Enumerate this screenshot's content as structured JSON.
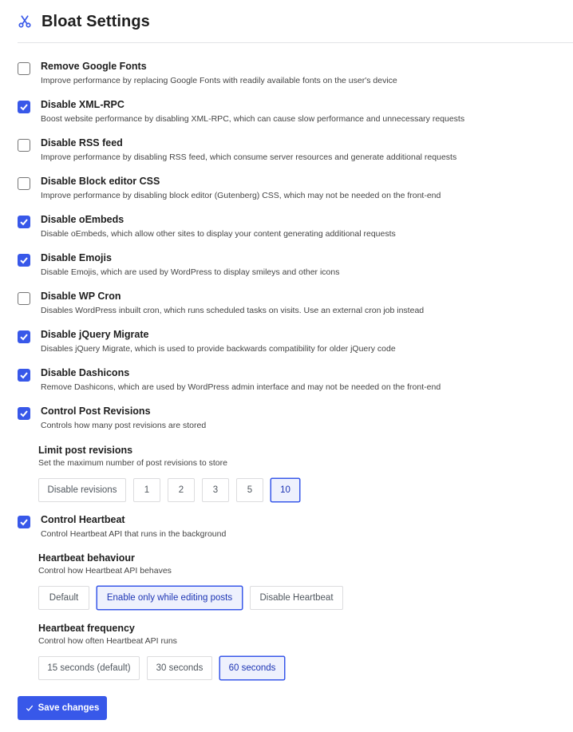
{
  "header": {
    "title": "Bloat Settings",
    "icon": "scissors-icon"
  },
  "accent": "#3858e9",
  "settings": [
    {
      "label": "Remove Google Fonts",
      "desc": "Improve performance by replacing Google Fonts with readily available fonts on the user's device",
      "checked": false
    },
    {
      "label": "Disable XML-RPC",
      "desc": "Boost website performance by disabling XML-RPC, which can cause slow performance and unnecessary requests",
      "checked": true
    },
    {
      "label": "Disable RSS feed",
      "desc": "Improve performance by disabling RSS feed, which consume server resources and generate additional requests",
      "checked": false
    },
    {
      "label": "Disable Block editor CSS",
      "desc": "Improve performance by disabling block editor (Gutenberg) CSS, which may not be needed on the front-end",
      "checked": false
    },
    {
      "label": "Disable oEmbeds",
      "desc": "Disable oEmbeds, which allow other sites to display your content generating additional requests",
      "checked": true
    },
    {
      "label": "Disable Emojis",
      "desc": "Disable Emojis, which are used by WordPress to display smileys and other icons",
      "checked": true
    },
    {
      "label": "Disable WP Cron",
      "desc": "Disables WordPress inbuilt cron, which runs scheduled tasks on visits. Use an external cron job instead",
      "checked": false
    },
    {
      "label": "Disable jQuery Migrate",
      "desc": "Disables jQuery Migrate, which is used to provide backwards compatibility for older jQuery code",
      "checked": true
    },
    {
      "label": "Disable Dashicons",
      "desc": "Remove Dashicons, which are used by WordPress admin interface and may not be needed on the front-end",
      "checked": true
    },
    {
      "label": "Control Post Revisions",
      "desc": "Controls how many post revisions are stored",
      "checked": true
    },
    {
      "label": "Control Heartbeat",
      "desc": "Control Heartbeat API that runs in the background",
      "checked": true
    }
  ],
  "revisions": {
    "label": "Limit post revisions",
    "desc": "Set the maximum number of post revisions to store",
    "options": [
      "Disable revisions",
      "1",
      "2",
      "3",
      "5",
      "10"
    ],
    "selected": "10"
  },
  "heartbeat_behaviour": {
    "label": "Heartbeat behaviour",
    "desc": "Control how Heartbeat API behaves",
    "options": [
      "Default",
      "Enable only while editing posts",
      "Disable Heartbeat"
    ],
    "selected": "Enable only while editing posts"
  },
  "heartbeat_frequency": {
    "label": "Heartbeat frequency",
    "desc": "Control how often Heartbeat API runs",
    "options": [
      "15 seconds (default)",
      "30 seconds",
      "60 seconds"
    ],
    "selected": "60 seconds"
  },
  "save_label": "Save changes"
}
